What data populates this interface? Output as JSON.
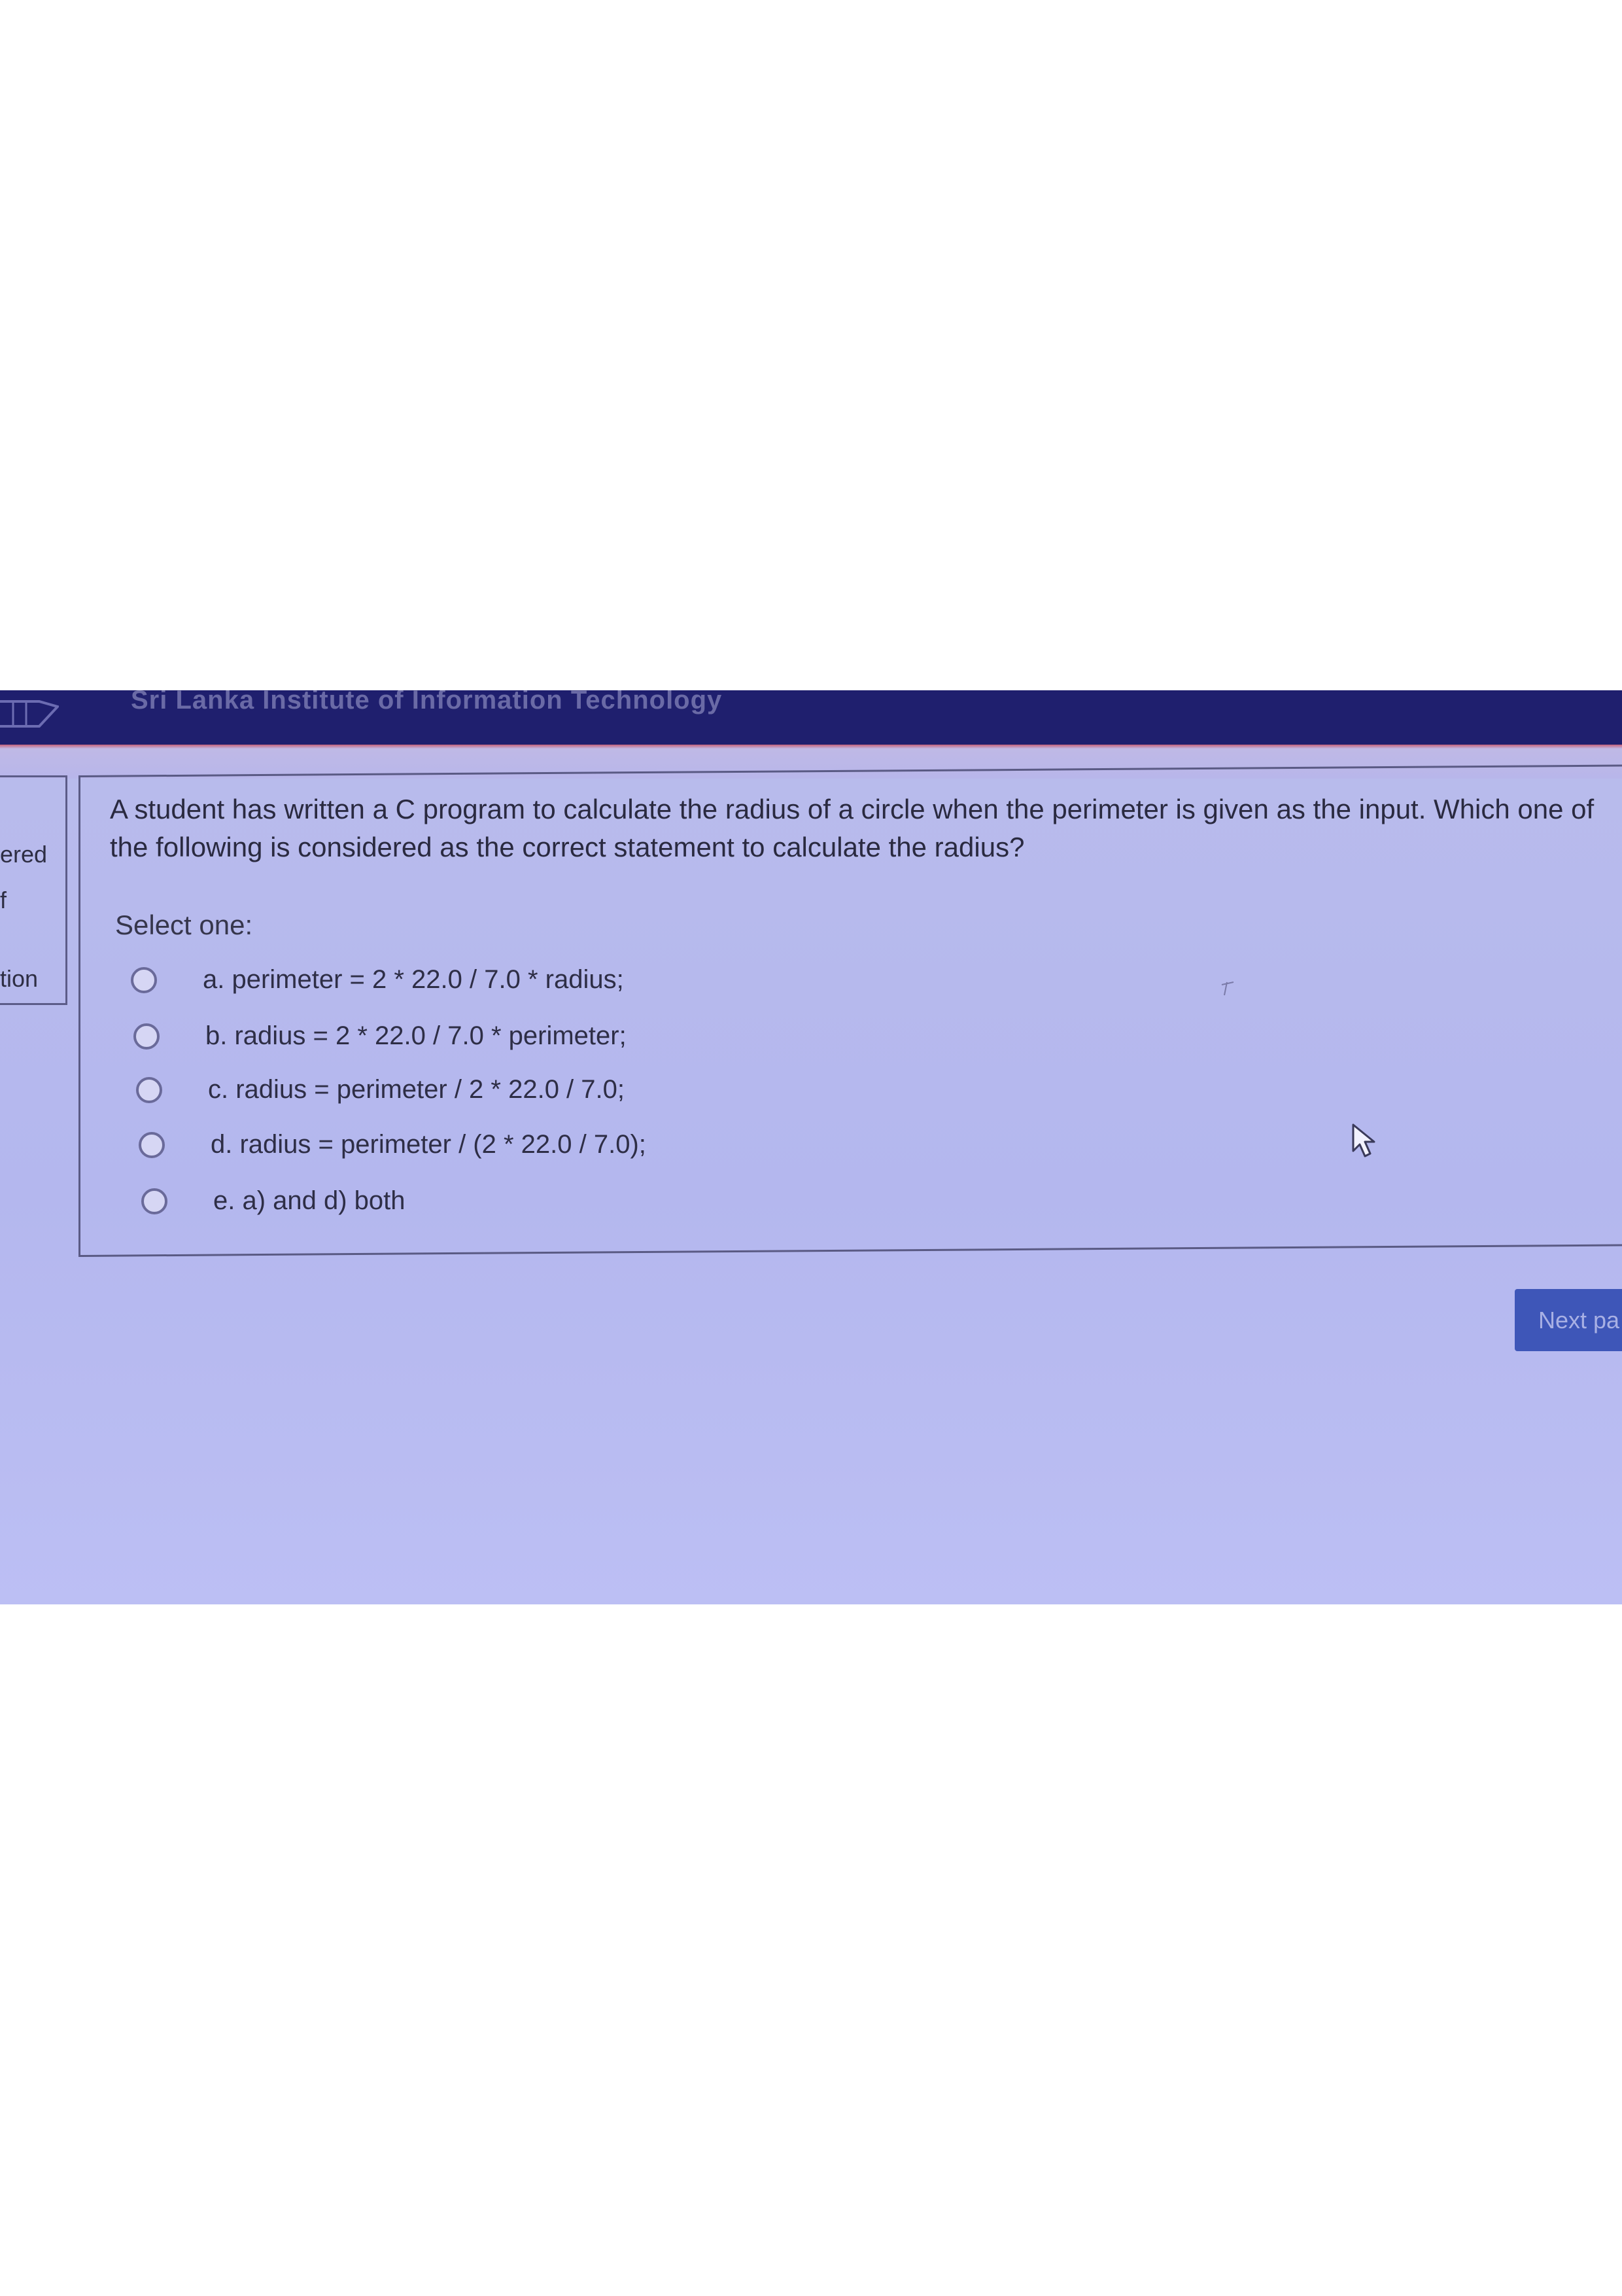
{
  "header": {
    "institute_name": "Sri Lanka Institute of Information Technology"
  },
  "sidebar": {
    "fragment_1": "ered",
    "fragment_2": "f",
    "fragment_3": "tion"
  },
  "question": {
    "text": "A student has written a C program to calculate the radius of a circle when the perimeter is given as the input. Which one of the following is considered as the correct statement to calculate the radius?",
    "prompt": "Select one:",
    "options": [
      {
        "label": "a. perimeter = 2 * 22.0 / 7.0 * radius;"
      },
      {
        "label": "b. radius = 2 * 22.0 / 7.0 * perimeter;"
      },
      {
        "label": "c. radius = perimeter / 2 * 22.0 / 7.0;"
      },
      {
        "label": "d. radius = perimeter / (2 * 22.0 / 7.0);"
      },
      {
        "label": "e. a) and d) both"
      }
    ]
  },
  "navigation": {
    "next_label": "Next pa"
  },
  "icons": {
    "logo": "university-logo-icon",
    "cursor": "mouse-pointer-icon",
    "mark": "small-mark-icon"
  },
  "colors": {
    "header_bg": "#1f1f6e",
    "page_bg": "#b8baee",
    "accent_button": "#3e56b8",
    "stripe": "#c4617a"
  }
}
